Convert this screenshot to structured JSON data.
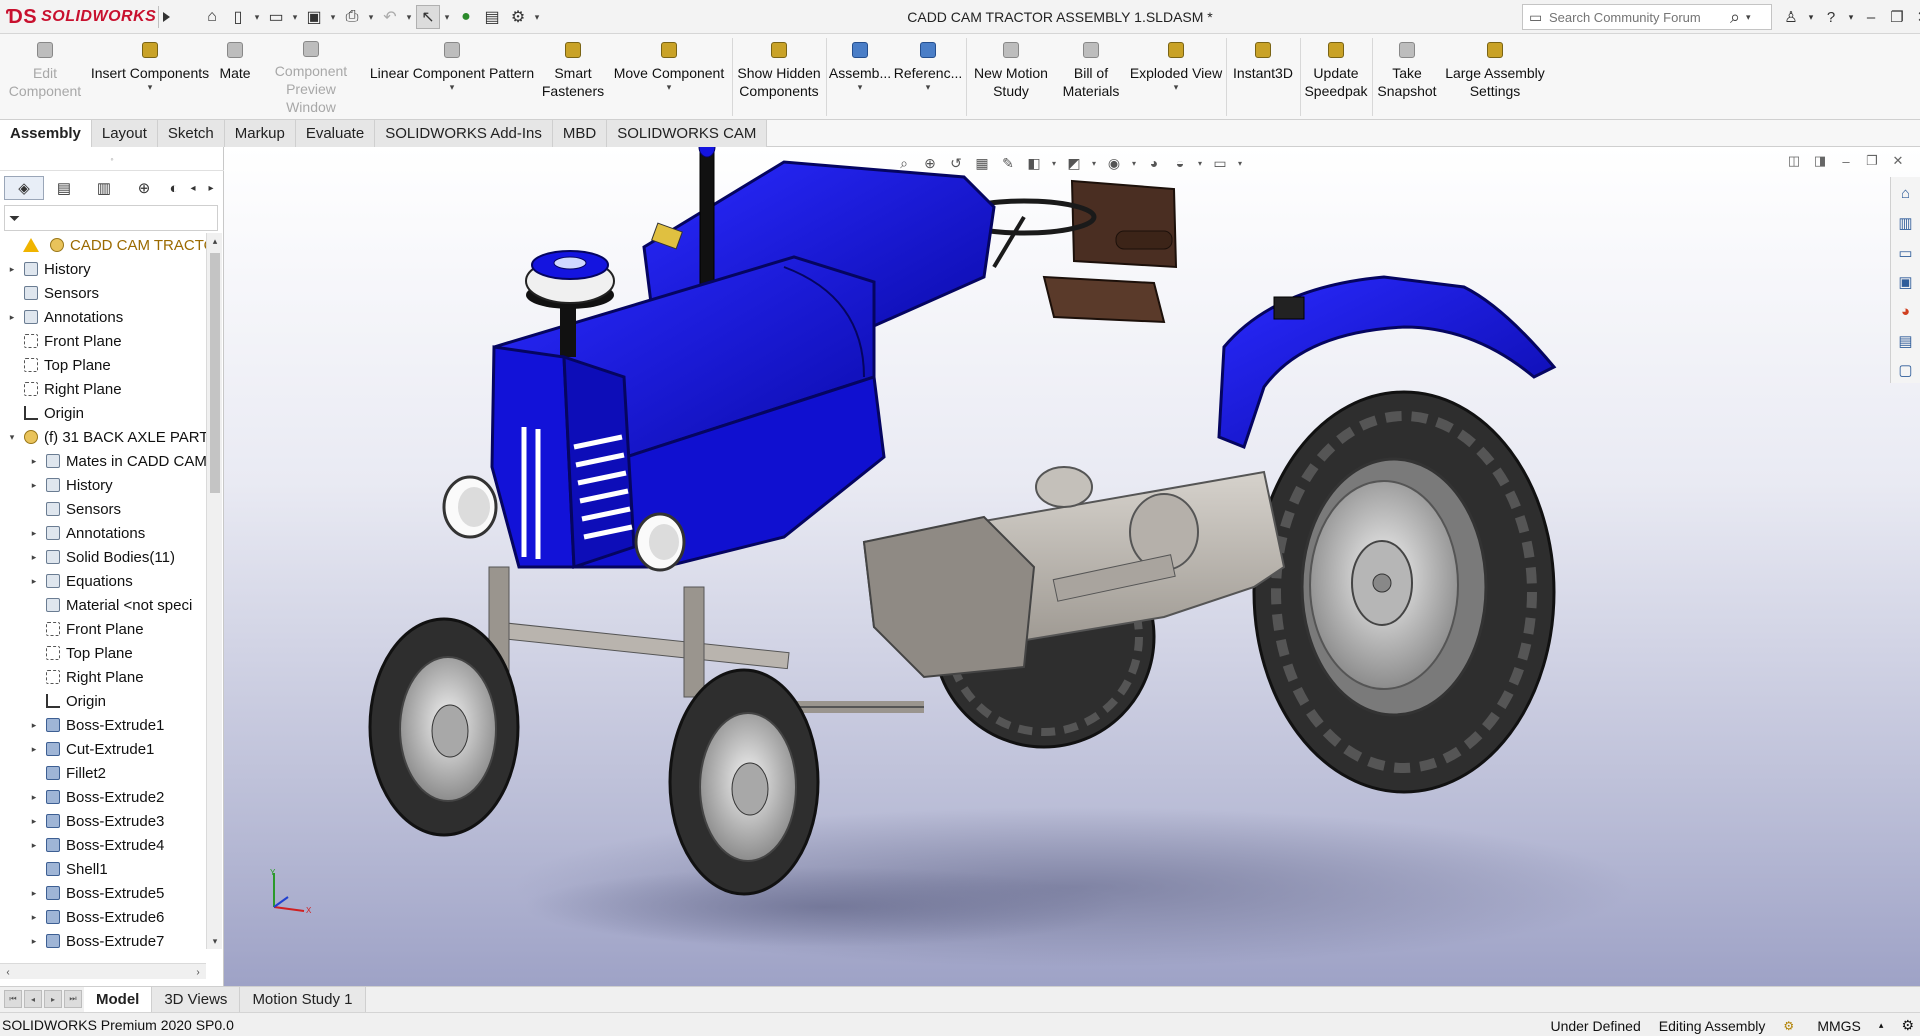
{
  "titlebar": {
    "app_name": "SOLIDWORKS",
    "document_title": "CADD CAM TRACTOR ASSEMBLY 1.SLDASM *",
    "search_placeholder": "Search Community Forum"
  },
  "commands": [
    {
      "label": "Edit Component",
      "disabled": true,
      "icon": "edit-component-icon"
    },
    {
      "label": "Insert Components",
      "icon": "insert-components-icon"
    },
    {
      "label": "Mate",
      "icon": "mate-icon"
    },
    {
      "label": "Component Preview Window",
      "disabled": true,
      "icon": "preview-window-icon"
    },
    {
      "label": "Linear Component Pattern",
      "icon": "linear-pattern-icon"
    },
    {
      "label": "Smart Fasteners",
      "icon": "smart-fasteners-icon"
    },
    {
      "label": "Move Component",
      "icon": "move-component-icon"
    },
    {
      "label": "Show Hidden Components",
      "icon": "show-hidden-icon"
    },
    {
      "label": "Assemb...",
      "icon": "assembly-features-icon"
    },
    {
      "label": "Referenc...",
      "icon": "reference-geometry-icon"
    },
    {
      "label": "New Motion Study",
      "icon": "motion-study-icon"
    },
    {
      "label": "Bill of Materials",
      "icon": "bom-icon"
    },
    {
      "label": "Exploded View",
      "icon": "exploded-view-icon"
    },
    {
      "label": "Instant3D",
      "icon": "instant3d-icon"
    },
    {
      "label": "Update Speedpak",
      "icon": "speedpak-icon"
    },
    {
      "label": "Take Snapshot",
      "icon": "snapshot-icon"
    },
    {
      "label": "Large Assembly Settings",
      "icon": "large-assembly-icon"
    }
  ],
  "tabs": [
    "Assembly",
    "Layout",
    "Sketch",
    "Markup",
    "Evaluate",
    "SOLIDWORKS Add-Ins",
    "MBD",
    "SOLIDWORKS CAM"
  ],
  "active_tab": "Assembly",
  "tree": [
    {
      "label": "CADD CAM TRACTOR ...",
      "level": 0,
      "icon": "assembly-icon",
      "root": true
    },
    {
      "label": "History",
      "level": 0,
      "icon": "history-icon",
      "expandable": true
    },
    {
      "label": "Sensors",
      "level": 0,
      "icon": "sensors-icon"
    },
    {
      "label": "Annotations",
      "level": 0,
      "icon": "annotations-icon",
      "expandable": true
    },
    {
      "label": "Front Plane",
      "level": 0,
      "icon": "plane-icon"
    },
    {
      "label": "Top Plane",
      "level": 0,
      "icon": "plane-icon"
    },
    {
      "label": "Right Plane",
      "level": 0,
      "icon": "plane-icon"
    },
    {
      "label": "Origin",
      "level": 0,
      "icon": "origin-icon"
    },
    {
      "label": "(f) 31 BACK AXLE PART",
      "level": 0,
      "icon": "part-icon",
      "expanded": true
    },
    {
      "label": "Mates in CADD CAM",
      "level": 1,
      "icon": "mates-icon",
      "expandable": true
    },
    {
      "label": "History",
      "level": 1,
      "icon": "history-icon",
      "expandable": true
    },
    {
      "label": "Sensors",
      "level": 1,
      "icon": "sensors-icon"
    },
    {
      "label": "Annotations",
      "level": 1,
      "icon": "annotations-icon",
      "expandable": true
    },
    {
      "label": "Solid Bodies(11)",
      "level": 1,
      "icon": "solid-bodies-icon",
      "expandable": true
    },
    {
      "label": "Equations",
      "level": 1,
      "icon": "equations-icon",
      "expandable": true
    },
    {
      "label": "Material <not speci",
      "level": 1,
      "icon": "material-icon"
    },
    {
      "label": "Front Plane",
      "level": 1,
      "icon": "plane-icon"
    },
    {
      "label": "Top Plane",
      "level": 1,
      "icon": "plane-icon"
    },
    {
      "label": "Right Plane",
      "level": 1,
      "icon": "plane-icon"
    },
    {
      "label": "Origin",
      "level": 1,
      "icon": "origin-icon"
    },
    {
      "label": "Boss-Extrude1",
      "level": 1,
      "icon": "extrude-icon",
      "expandable": true
    },
    {
      "label": "Cut-Extrude1",
      "level": 1,
      "icon": "cut-extrude-icon",
      "expandable": true
    },
    {
      "label": "Fillet2",
      "level": 1,
      "icon": "fillet-icon"
    },
    {
      "label": "Boss-Extrude2",
      "level": 1,
      "icon": "extrude-icon",
      "expandable": true
    },
    {
      "label": "Boss-Extrude3",
      "level": 1,
      "icon": "extrude-icon",
      "expandable": true
    },
    {
      "label": "Boss-Extrude4",
      "level": 1,
      "icon": "extrude-icon",
      "expandable": true
    },
    {
      "label": "Shell1",
      "level": 1,
      "icon": "shell-icon"
    },
    {
      "label": "Boss-Extrude5",
      "level": 1,
      "icon": "extrude-icon",
      "expandable": true
    },
    {
      "label": "Boss-Extrude6",
      "level": 1,
      "icon": "extrude-icon",
      "expandable": true
    },
    {
      "label": "Boss-Extrude7",
      "level": 1,
      "icon": "extrude-icon",
      "expandable": true
    }
  ],
  "bottom_tabs": [
    "Model",
    "3D Views",
    "Motion Study 1"
  ],
  "active_bottom_tab": "Model",
  "status": {
    "product": "SOLIDWORKS Premium 2020 SP0.0",
    "state": "Under Defined",
    "mode": "Editing Assembly",
    "units": "MMGS"
  },
  "colors": {
    "tractor_body": "#1414e0",
    "tractor_body_dark": "#0a0a9a",
    "chassis": "#bdb8b1",
    "tire": "#3a3a3a",
    "rim": "#c9c9c9",
    "seat": "#5a3a2a",
    "brand_red": "#c8102e"
  }
}
